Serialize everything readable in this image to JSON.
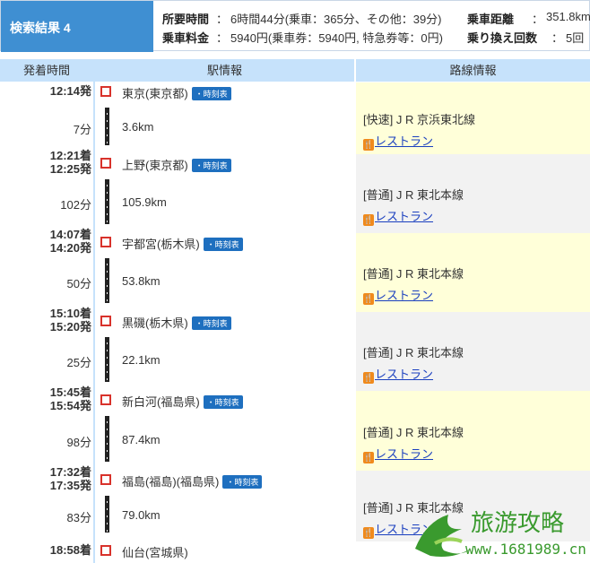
{
  "summary": {
    "title": "検索結果 4",
    "time_label": "所要時間",
    "time_value": "6時間44分(乗車：365分、その他：39分)",
    "distance_label": "乗車距離",
    "distance_value": "351.8km",
    "fare_label": "乗車料金",
    "fare_value": "5940円(乗車券：5940円, 特急券等：0円)",
    "transfers_label": "乗り換え回数",
    "transfers_value": "5回",
    "sep": "："
  },
  "headers": {
    "time": "発着時間",
    "station": "駅情報",
    "route": "路線情報"
  },
  "timetable_label": "・時刻表",
  "restaurant_label": "レストラン",
  "stations": [
    {
      "times": [
        "12:14発"
      ],
      "name": "東京(東京都)"
    },
    {
      "times": [
        "12:21着",
        "12:25発"
      ],
      "name": "上野(東京都)"
    },
    {
      "times": [
        "14:07着",
        "14:20発"
      ],
      "name": "宇都宮(栃木県)"
    },
    {
      "times": [
        "15:10着",
        "15:20発"
      ],
      "name": "黒磯(栃木県)"
    },
    {
      "times": [
        "15:45着",
        "15:54発"
      ],
      "name": "新白河(福島県)"
    },
    {
      "times": [
        "17:32着",
        "17:35発"
      ],
      "name": "福島(福島)(福島県)"
    },
    {
      "times": [
        "18:58着"
      ],
      "name": "仙台(宮城県)"
    }
  ],
  "segments": [
    {
      "minutes": "7分",
      "km": "3.6km",
      "route": "[快速] J R 京浜東北線"
    },
    {
      "minutes": "102分",
      "km": "105.9km",
      "route": "[普通] J R 東北本線"
    },
    {
      "minutes": "50分",
      "km": "53.8km",
      "route": "[普通] J R 東北本線"
    },
    {
      "minutes": "25分",
      "km": "22.1km",
      "route": "[普通] J R 東北本線"
    },
    {
      "minutes": "98分",
      "km": "87.4km",
      "route": "[普通] J R 東北本線"
    },
    {
      "minutes": "83分",
      "km": "79.0km",
      "route": "[普通] J R 東北本線"
    }
  ],
  "colors": {
    "accent": "#3f8fd2",
    "header_bg": "#c6e2fb",
    "route_yellow": "#ffffd9",
    "route_gray": "#f2f2f2",
    "station_marker": "#d8322b"
  },
  "watermark": {
    "text": "旅游攻略",
    "url": "www.1681989.cn"
  }
}
